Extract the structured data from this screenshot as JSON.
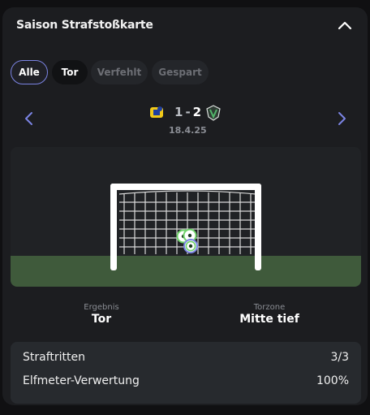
{
  "card": {
    "title": "Saison Strafstoßkarte"
  },
  "filters": [
    "Alle",
    "Tor",
    "Verfehlt",
    "Gespart"
  ],
  "match": {
    "home_goals": "1",
    "separator": "-",
    "away_goals": "2",
    "date": "18.4.25"
  },
  "result": {
    "label": "Ergebnis",
    "value": "Tor"
  },
  "zone": {
    "label": "Torzone",
    "value": "Mitte tief"
  },
  "stats": [
    {
      "label": "Straftritten",
      "value": "3/3"
    },
    {
      "label": "Elfmeter-Verwertung",
      "value": "100%"
    }
  ],
  "colors": {
    "accent": "#7b84e3",
    "grass": "#3f5a3b",
    "ball_ring": "#6fd26a"
  }
}
